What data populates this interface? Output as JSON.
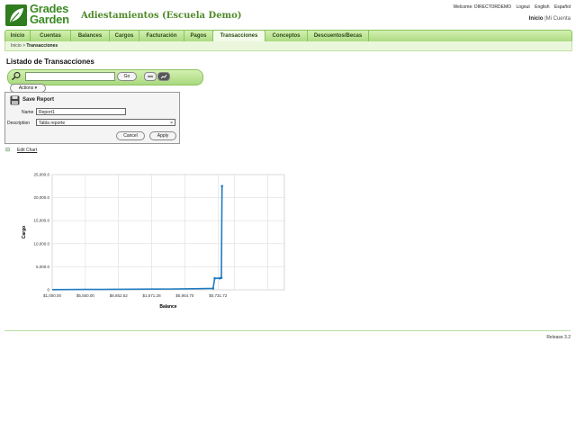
{
  "brand": {
    "line1": "Grades",
    "line2": "Garden"
  },
  "app_title": "Adiestamientos (Escuela Demo)",
  "top_links": {
    "welcome": "Welcome: DIRECTORDEMO",
    "logout": "Logout",
    "english": "English",
    "espanol": "Español"
  },
  "user_links": {
    "inicio": "Inicio",
    "separator": "|",
    "cuenta": "Mi Cuenta"
  },
  "nav": {
    "items": [
      {
        "label": "Inicio"
      },
      {
        "label": "Cuentas"
      },
      {
        "label": "Balances"
      },
      {
        "label": "Cargos"
      },
      {
        "label": "Facturación"
      },
      {
        "label": "Pagos"
      },
      {
        "label": "Transacciones"
      },
      {
        "label": "Conceptos"
      },
      {
        "label": "Descuentos/Becas"
      }
    ],
    "active": "Transacciones"
  },
  "breadcrumb": {
    "home": "Inicio",
    "sep": ">",
    "current": "Transacciones"
  },
  "page_title": "Listado de Transacciones",
  "search": {
    "value": "",
    "go_label": "Go"
  },
  "actions_label": "Actions",
  "save_report": {
    "title": "Save Report",
    "name_label": "Name",
    "name_value": "Report1",
    "description_label": "Description",
    "description_value": "Tabla reporte",
    "clear_glyph": "×",
    "cancel_label": "Cancel",
    "apply_label": "Apply"
  },
  "edit_chart_label": "Edit Chart",
  "collapse_glyph": "⊟",
  "release": "Release 3.2",
  "colors": {
    "nav_green": "#a8d97e",
    "brand_green": "#3a8a22",
    "series": "#1f7bc0"
  },
  "chart_data": {
    "type": "line",
    "xlabel": "Balance",
    "ylabel": "Cargo",
    "x_tick_labels": [
      "$1,000.00",
      "$5,550.00",
      "$8,852.52",
      "$1,571.28",
      "$5,954.70",
      "$0,731.72"
    ],
    "y_tick_labels": [
      "0",
      "5,000.0",
      "10,000.0",
      "15,000.0",
      "20,000.0",
      "25,000.0"
    ],
    "y_tick_values": [
      0,
      5000,
      10000,
      15000,
      20000,
      25000
    ],
    "x_tick_values": [
      0,
      1,
      2,
      3,
      4,
      5
    ],
    "xlim": [
      0,
      7
    ],
    "ylim": [
      0,
      25000
    ],
    "grid": true,
    "series": [
      {
        "values": [
          [
            0.0,
            40
          ],
          [
            0.5,
            60
          ],
          [
            1.0,
            80
          ],
          [
            1.5,
            90
          ],
          [
            2.0,
            110
          ],
          [
            2.5,
            130
          ],
          [
            3.0,
            150
          ],
          [
            3.5,
            170
          ],
          [
            4.0,
            200
          ],
          [
            4.5,
            260
          ],
          [
            4.85,
            300
          ],
          [
            4.9,
            2500
          ],
          [
            5.05,
            2500
          ],
          [
            5.1,
            2600
          ],
          [
            5.12,
            22500
          ]
        ]
      }
    ]
  }
}
